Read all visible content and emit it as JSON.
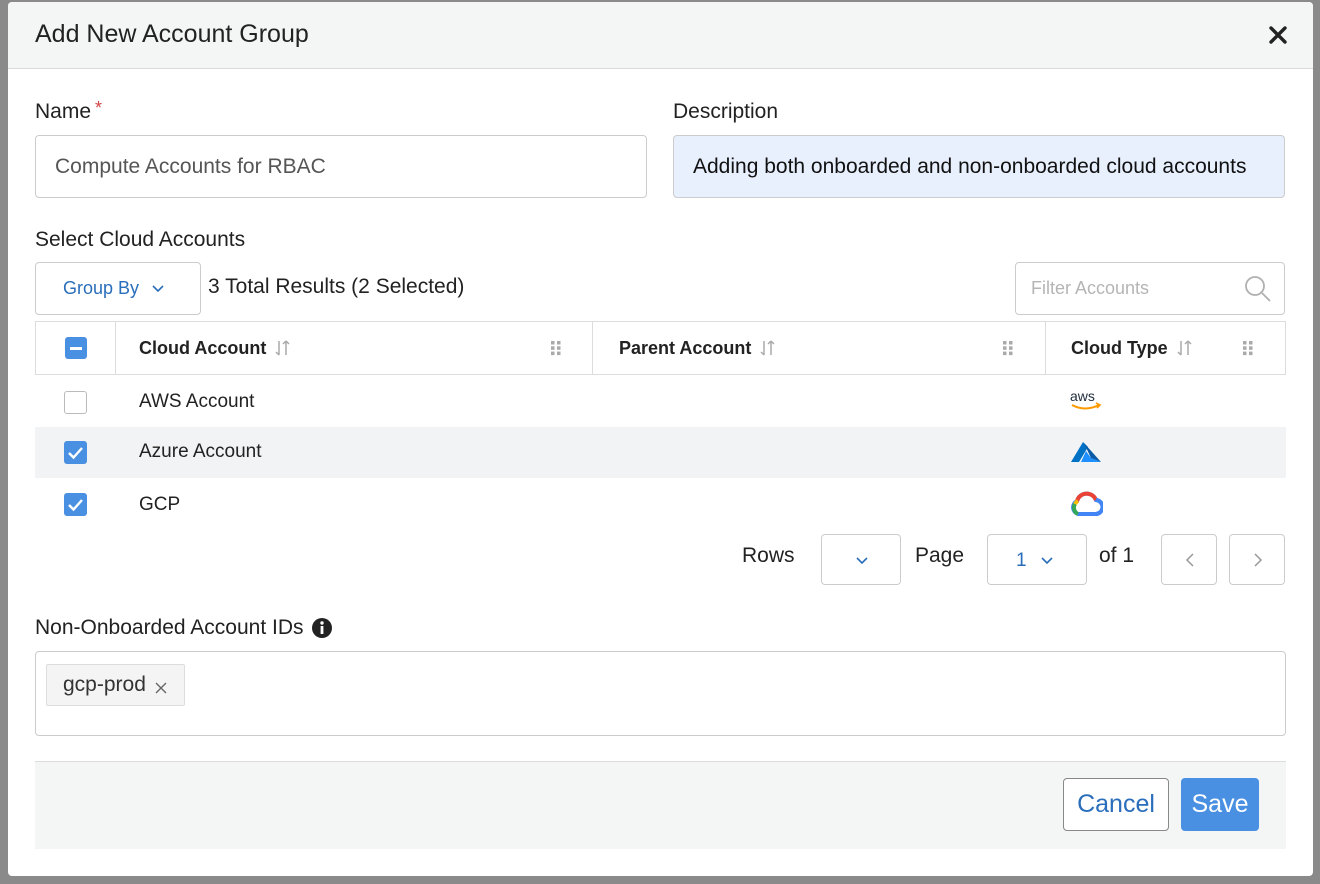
{
  "dialog": {
    "title": "Add New Account Group"
  },
  "form": {
    "name_label": "Name",
    "name_required": "*",
    "name_value": "Compute Accounts for RBAC",
    "description_label": "Description",
    "description_value": "Adding both onboarded and non-onboarded cloud accounts"
  },
  "accounts": {
    "section_label": "Select Cloud Accounts",
    "group_by_label": "Group By",
    "results_text": "3 Total Results (2 Selected)",
    "filter_placeholder": "Filter Accounts",
    "columns": [
      "Cloud Account",
      "Parent Account",
      "Cloud Type"
    ],
    "rows": [
      {
        "name": "AWS Account",
        "parent": "",
        "cloud_type": "aws-logo-icon",
        "checked": false
      },
      {
        "name": "Azure Account",
        "parent": "",
        "cloud_type": "azure-logo-icon",
        "checked": true
      },
      {
        "name": "GCP",
        "parent": "",
        "cloud_type": "gcp-logo-icon",
        "checked": true
      }
    ]
  },
  "pagination": {
    "rows_label": "Rows",
    "rows_value": "",
    "page_label": "Page",
    "page_value": "1",
    "of_text": "of 1"
  },
  "non_onboarded": {
    "label": "Non-Onboarded Account IDs",
    "tags": [
      "gcp-prod"
    ]
  },
  "footer": {
    "cancel_label": "Cancel",
    "save_label": "Save"
  },
  "colors": {
    "accent": "#4a90e2",
    "link": "#2a6ebb",
    "required": "#d14343",
    "description_bg": "#e8f0fe"
  }
}
